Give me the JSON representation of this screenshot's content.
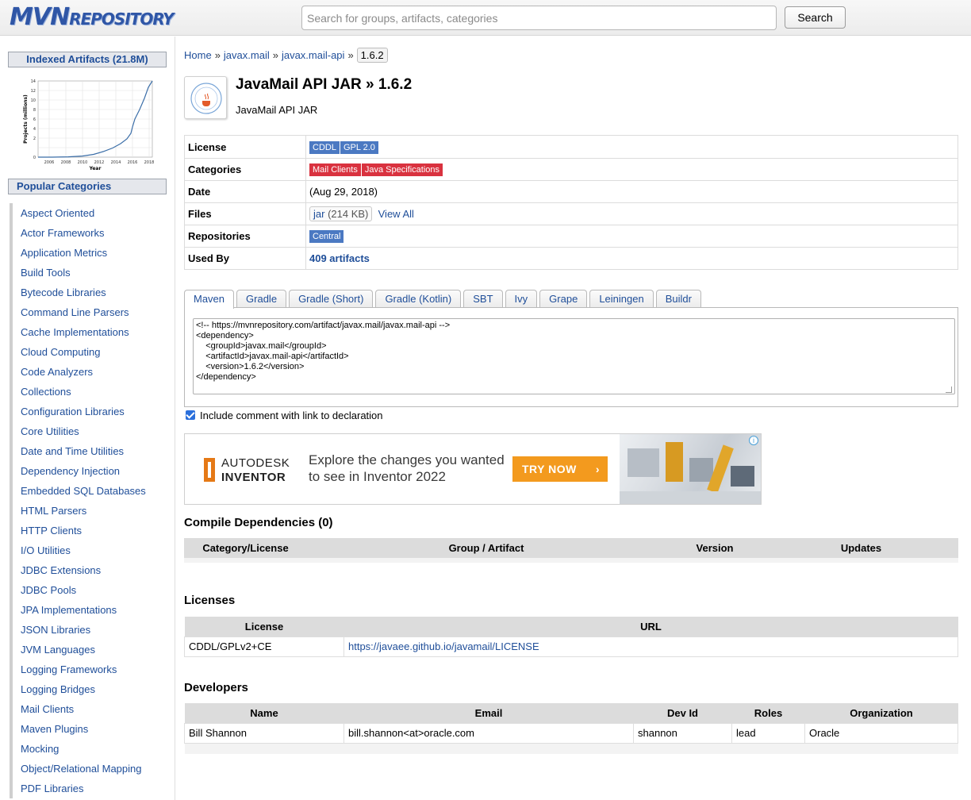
{
  "header": {
    "logo_big": "MVN",
    "logo_small": "REPOSITORY",
    "search_placeholder": "Search for groups, artifacts, categories",
    "search_button": "Search"
  },
  "sidebar": {
    "indexed_title": "Indexed Artifacts (21.8M)",
    "chart": {
      "ylabel": "Projects (millions)",
      "xlabel": "Year",
      "yticks": [
        "14",
        "12",
        "10",
        "8",
        "6",
        "4",
        "2",
        "0"
      ],
      "xticks": [
        "2006",
        "2008",
        "2010",
        "2012",
        "2014",
        "2016",
        "2018"
      ]
    },
    "popular_title": "Popular Categories",
    "categories": [
      "Aspect Oriented",
      "Actor Frameworks",
      "Application Metrics",
      "Build Tools",
      "Bytecode Libraries",
      "Command Line Parsers",
      "Cache Implementations",
      "Cloud Computing",
      "Code Analyzers",
      "Collections",
      "Configuration Libraries",
      "Core Utilities",
      "Date and Time Utilities",
      "Dependency Injection",
      "Embedded SQL Databases",
      "HTML Parsers",
      "HTTP Clients",
      "I/O Utilities",
      "JDBC Extensions",
      "JDBC Pools",
      "JPA Implementations",
      "JSON Libraries",
      "JVM Languages",
      "Logging Frameworks",
      "Logging Bridges",
      "Mail Clients",
      "Maven Plugins",
      "Mocking",
      "Object/Relational Mapping",
      "PDF Libraries"
    ]
  },
  "breadcrumb": {
    "home": "Home",
    "group": "javax.mail",
    "artifact": "javax.mail-api",
    "version": "1.6.2",
    "separator": "»"
  },
  "artifact": {
    "title": "JavaMail API JAR » 1.6.2",
    "subtitle": "JavaMail API JAR"
  },
  "info": {
    "license_label": "License",
    "licenses": [
      "CDDL",
      "GPL 2.0"
    ],
    "categories_label": "Categories",
    "categories": [
      "Mail Clients",
      "Java Specifications"
    ],
    "date_label": "Date",
    "date": "(Aug 29, 2018)",
    "files_label": "Files",
    "file_type": "jar",
    "file_size": "(214 KB)",
    "view_all": "View All",
    "repositories_label": "Repositories",
    "repository": "Central",
    "used_by_label": "Used By",
    "used_by": "409 artifacts"
  },
  "tabs": [
    "Maven",
    "Gradle",
    "Gradle (Short)",
    "Gradle (Kotlin)",
    "SBT",
    "Ivy",
    "Grape",
    "Leiningen",
    "Buildr"
  ],
  "snippet": "<!-- https://mvnrepository.com/artifact/javax.mail/javax.mail-api -->\n<dependency>\n    <groupId>javax.mail</groupId>\n    <artifactId>javax.mail-api</artifactId>\n    <version>1.6.2</version>\n</dependency>",
  "include_comment_label": "Include comment with link to declaration",
  "ad": {
    "brand_line1": "AUTODESK",
    "brand_line2": "INVENTOR",
    "text": "Explore the changes you wanted to see in Inventor 2022",
    "cta": "TRY NOW",
    "cta_chevron": "›",
    "info": "i"
  },
  "compile_deps": {
    "title": "Compile Dependencies (0)",
    "headers": [
      "Category/License",
      "Group / Artifact",
      "Version",
      "Updates"
    ]
  },
  "licenses": {
    "title": "Licenses",
    "headers": [
      "License",
      "URL"
    ],
    "rows": [
      [
        "CDDL/GPLv2+CE",
        "https://javaee.github.io/javamail/LICENSE"
      ]
    ]
  },
  "developers": {
    "title": "Developers",
    "headers": [
      "Name",
      "Email",
      "Dev Id",
      "Roles",
      "Organization"
    ],
    "rows": [
      [
        "Bill Shannon",
        "bill.shannon<at>oracle.com",
        "shannon",
        "lead",
        "Oracle"
      ]
    ]
  },
  "colors": {
    "link": "#1f4e99",
    "badge_blue": "#4b79c2",
    "badge_red": "#d9323f",
    "ad_orange": "#f39a1e"
  }
}
